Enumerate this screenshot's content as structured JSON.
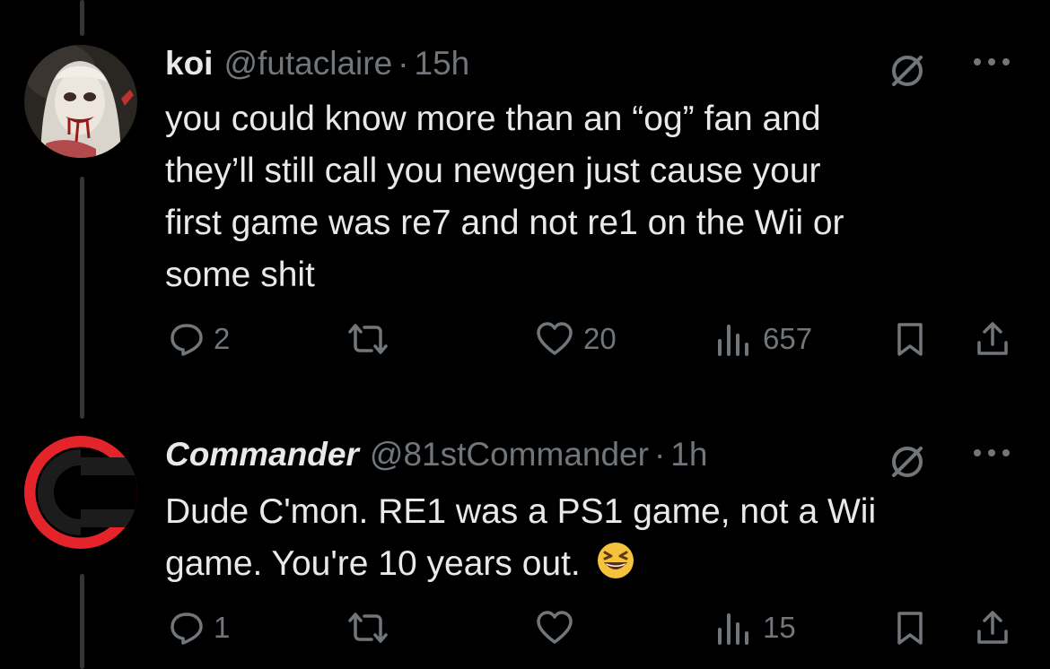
{
  "tweets": [
    {
      "name": "koi",
      "handle": "@futaclaire",
      "time": "15h",
      "lines": [
        "you could know more than an “og” fan and",
        "they’ll still call you newgen just cause your",
        "first game was re7 and not re1 on the Wii or",
        "some shit"
      ],
      "replies": "2",
      "reposts": "",
      "likes": "20",
      "views": "657"
    },
    {
      "name": "Commander",
      "handle": "@81stCommander",
      "time": "1h",
      "lines": [
        "Dude C'mon. RE1 was a PS1 game, not a Wii",
        "game. You're 10 years out."
      ],
      "emoji": "grinning-squinting-face",
      "replies": "1",
      "reposts": "",
      "likes": "",
      "views": "15"
    }
  ],
  "colors": {
    "background": "#000000",
    "text": "#e7e9ea",
    "muted": "#71767b",
    "thread_line": "#333639",
    "commander_red": "#e3242b"
  }
}
